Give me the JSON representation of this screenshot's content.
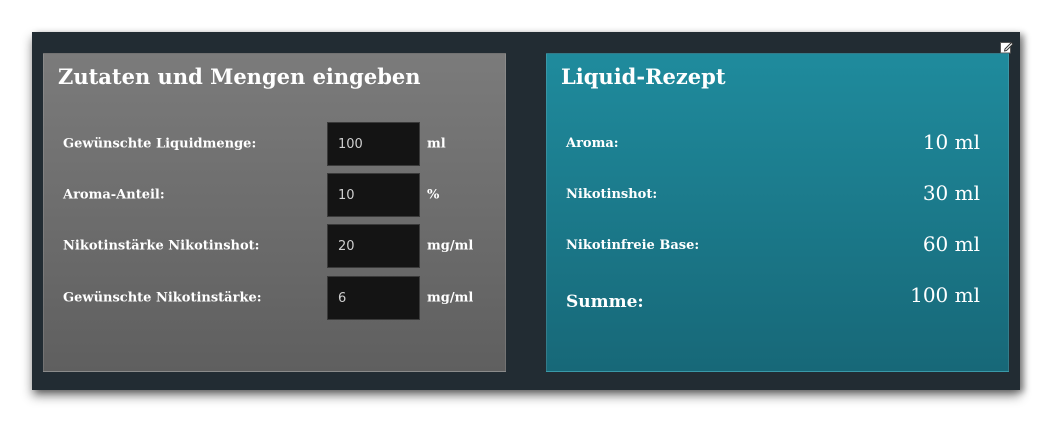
{
  "input_panel": {
    "title": "Zutaten und Mengen eingeben",
    "fields": [
      {
        "label": "Gewünschte Liquidmenge:",
        "value": "100",
        "unit": "ml"
      },
      {
        "label": "Aroma-Anteil:",
        "value": "10",
        "unit": "%"
      },
      {
        "label": "Nikotinstärke Nikotinshot:",
        "value": "20",
        "unit": "mg/ml"
      },
      {
        "label": "Gewünschte Nikotinstärke:",
        "value": "6",
        "unit": "mg/ml"
      }
    ]
  },
  "result_panel": {
    "title": "Liquid-Rezept",
    "rows": [
      {
        "label": "Aroma:",
        "value": "10 ml"
      },
      {
        "label": "Nikotinshot:",
        "value": "30 ml"
      },
      {
        "label": "Nikotinfreie Base:",
        "value": "60 ml"
      }
    ],
    "sum": {
      "label": "Summe:",
      "value": "100 ml"
    }
  },
  "icons": {
    "edit": "edit-icon"
  },
  "colors": {
    "outer_background": "#222c33",
    "input_panel": "#707070",
    "result_panel": "#1c7e8f",
    "input_field": "#141414"
  }
}
